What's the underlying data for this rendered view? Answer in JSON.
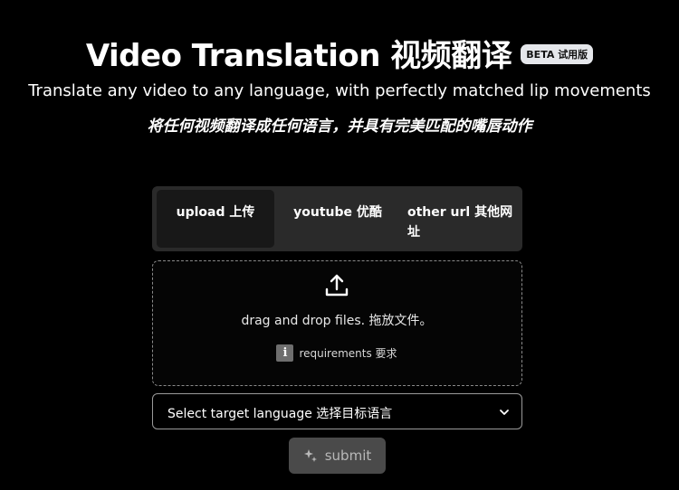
{
  "header": {
    "title": "Video Translation 视频翻译",
    "badge": "BETA 试用版",
    "subtitle_en": "Translate any video to any language, with perfectly matched lip movements",
    "subtitle_zh": "将任何视频翻译成任何语言，并具有完美匹配的嘴唇动作"
  },
  "tabs": {
    "upload": "upload 上传",
    "youtube": "youtube 优酷",
    "other_url_line1": "other url 其他网",
    "other_url_line2": "址",
    "active": "upload"
  },
  "dropzone": {
    "text": "drag and drop files. 拖放文件。",
    "requirements": "requirements 要求",
    "info_glyph": "i"
  },
  "language_select": {
    "placeholder": "Select target language 选择目标语言"
  },
  "submit": {
    "label": "submit"
  },
  "colors": {
    "background": "#000000",
    "tab_bar": "#2a2a2a",
    "tab_active": "#181818",
    "badge_bg": "#e5e7eb",
    "submit_bg": "#4a4a4a"
  },
  "icons": [
    "upload-icon",
    "info-icon",
    "chevron-down-icon",
    "sparkle-icon"
  ]
}
